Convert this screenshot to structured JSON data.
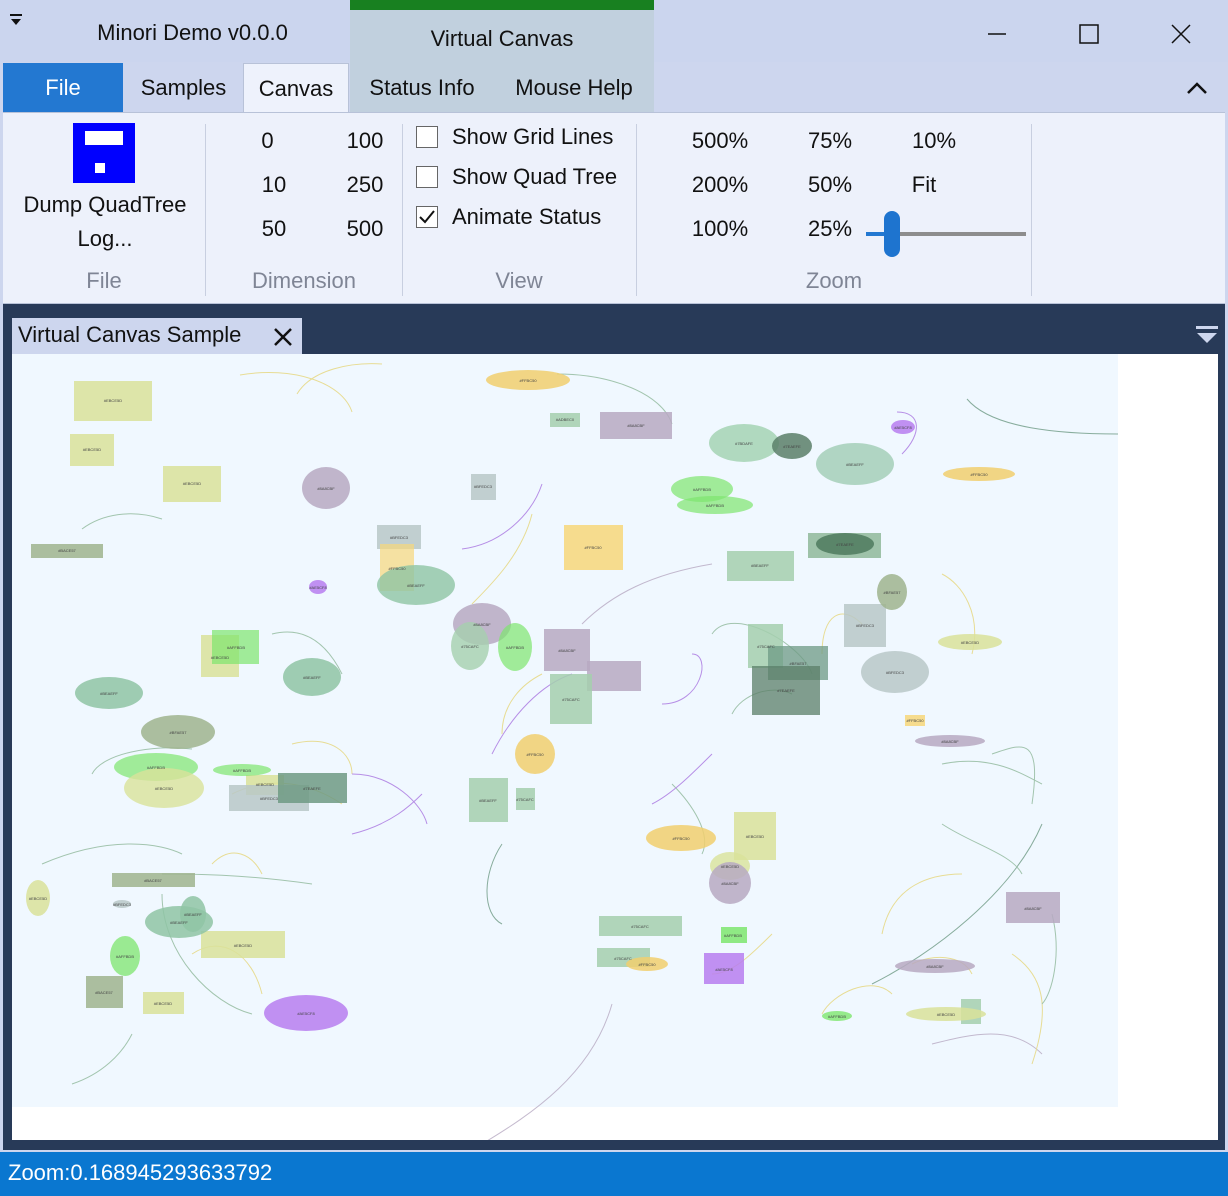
{
  "window": {
    "title": "Minori Demo v0.0.0",
    "contextual_tab_group": "Virtual Canvas",
    "contextual_color": "#188020"
  },
  "ribbon": {
    "file_tab": "File",
    "tabs": [
      "Samples",
      "Canvas",
      "Status Info",
      "Mouse Help"
    ],
    "selected_tab": "Canvas",
    "groups": {
      "file": {
        "label": "File",
        "button_line1": "Dump QuadTree",
        "button_line2": "Log..."
      },
      "dimension": {
        "label": "Dimension",
        "values": [
          "0",
          "100",
          "10",
          "250",
          "50",
          "500"
        ]
      },
      "view": {
        "label": "View",
        "checkboxes": [
          {
            "label": "Show Grid Lines",
            "checked": false
          },
          {
            "label": "Show Quad Tree",
            "checked": false
          },
          {
            "label": "Animate Status",
            "checked": true
          }
        ]
      },
      "zoom": {
        "label": "Zoom",
        "presets": [
          "500%",
          "75%",
          "10%",
          "200%",
          "50%",
          "Fit",
          "100%",
          "25%"
        ],
        "slider_value": 0.168945293633792
      }
    }
  },
  "document": {
    "tab_title": "Virtual Canvas Sample"
  },
  "status": {
    "text": "Zoom:0.168945293633792"
  },
  "icons": {
    "qat": "dropdown-arrow-icon",
    "minimize": "minimize-icon",
    "maximize": "maximize-icon",
    "close": "close-icon",
    "collapse": "chevron-up-icon",
    "save": "floppy-disk-icon",
    "doc_close": "close-icon",
    "doc_menu": "dropdown-menu-icon"
  },
  "colors": {
    "accent": "#2378d1",
    "status_bar": "#0a77d0",
    "doc_background": "#283a58",
    "canvas_background": "#f0f8ff"
  }
}
